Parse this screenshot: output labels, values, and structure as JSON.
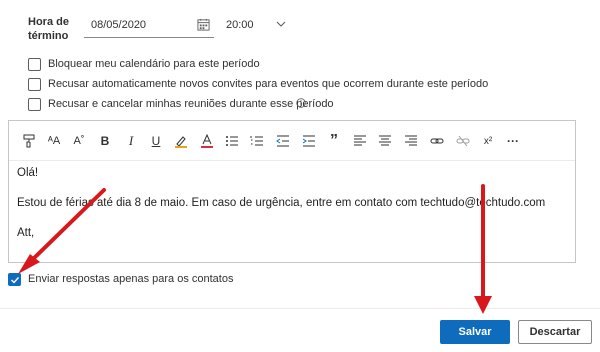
{
  "end": {
    "label": "Hora de término",
    "date": "08/05/2020",
    "time": "20:00"
  },
  "options": [
    {
      "label": "Bloquear meu calendário para este período",
      "checked": false
    },
    {
      "label": "Recusar automaticamente novos convites para eventos que ocorrem durante este período",
      "checked": false
    },
    {
      "label": "Recusar e cancelar minhas reuniões durante esse período",
      "checked": false
    }
  ],
  "toolbar": {
    "icons": [
      "format-painter-icon",
      "font-size-icon",
      "superscript-a-icon",
      "bold-icon",
      "italic-icon",
      "underline-icon",
      "highlight-icon",
      "font-color-icon",
      "bullets-icon",
      "numbering-icon",
      "decrease-indent-icon",
      "increase-indent-icon",
      "quote-icon",
      "align-left-icon",
      "align-center-icon",
      "align-right-icon",
      "link-icon",
      "unlink-icon",
      "superscript-icon",
      "more-icon"
    ],
    "bold": "B",
    "italic": "I",
    "underline": "U",
    "quote": "”",
    "superscript": "x²",
    "more": "···"
  },
  "message": {
    "line1": "Olá!",
    "line2": "Estou de férias até dia 8 de maio. Em caso de urgência, entre em contato com techtudo@techtudo.com",
    "line3": "Att,"
  },
  "reply_option": {
    "label": "Enviar respostas apenas para os contatos",
    "checked": true
  },
  "buttons": {
    "save": "Salvar",
    "discard": "Descartar"
  },
  "colors": {
    "accent": "#0f6cbd",
    "arrow": "#d7191c"
  }
}
